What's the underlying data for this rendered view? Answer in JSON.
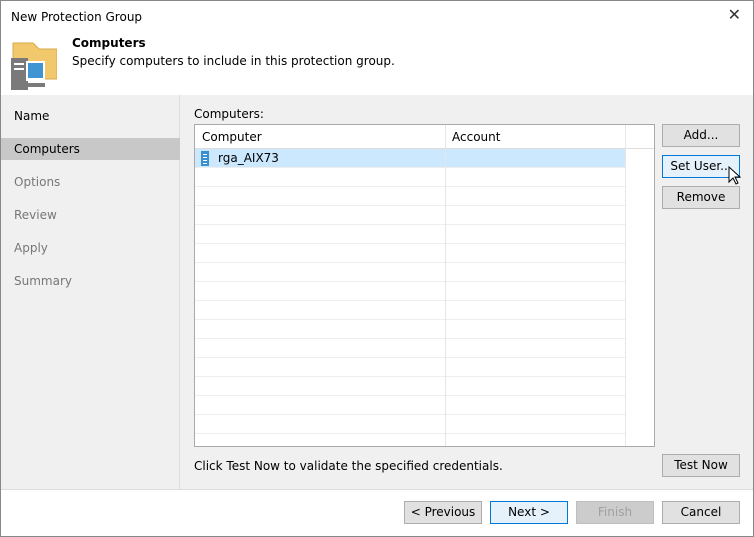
{
  "window": {
    "title": "New Protection Group"
  },
  "header": {
    "title": "Computers",
    "subtitle": "Specify computers to include in this protection group.",
    "icon": "folder-computer-icon"
  },
  "nav": {
    "items": [
      {
        "label": "Name",
        "state": "done"
      },
      {
        "label": "Computers",
        "state": "selected"
      },
      {
        "label": "Options",
        "state": "pending"
      },
      {
        "label": "Review",
        "state": "pending"
      },
      {
        "label": "Apply",
        "state": "pending"
      },
      {
        "label": "Summary",
        "state": "pending"
      }
    ]
  },
  "computers": {
    "label": "Computers:",
    "columns": [
      "Computer",
      "Account"
    ],
    "rows": [
      {
        "computer": "rga_AIX73",
        "account": "",
        "icon": "server-icon",
        "selected": true
      }
    ]
  },
  "buttons": {
    "add": "Add...",
    "set_user": "Set User...",
    "remove": "Remove",
    "test_now": "Test Now",
    "previous": "< Previous",
    "next": "Next >",
    "finish": "Finish",
    "cancel": "Cancel"
  },
  "hint": "Click Test Now to validate the specified credentials."
}
